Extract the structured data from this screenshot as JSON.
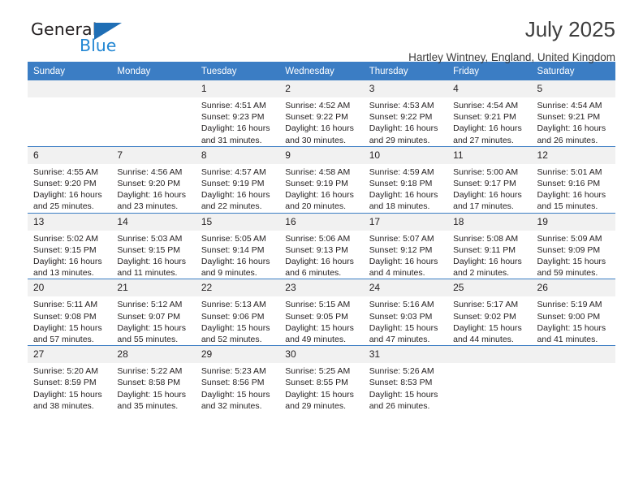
{
  "brand": {
    "name_part1": "General",
    "name_part2": "Blue",
    "triangle_color": "#1f6eb5",
    "blue_text_color": "#2387d3"
  },
  "header": {
    "month_title": "July 2025",
    "location": "Hartley Wintney, England, United Kingdom"
  },
  "theme": {
    "header_blue": "#3b7dc4",
    "daynum_bg": "#f1f1f1"
  },
  "weekday_headers": [
    "Sunday",
    "Monday",
    "Tuesday",
    "Wednesday",
    "Thursday",
    "Friday",
    "Saturday"
  ],
  "labels": {
    "sunrise_prefix": "Sunrise:",
    "sunset_prefix": "Sunset:",
    "daylight_prefix": "Daylight:"
  },
  "weeks": [
    [
      {
        "day": "",
        "empty": true
      },
      {
        "day": "",
        "empty": true
      },
      {
        "day": "1",
        "sunrise": "Sunrise: 4:51 AM",
        "sunset": "Sunset: 9:23 PM",
        "daylight_line1": "Daylight: 16 hours",
        "daylight_line2": "and 31 minutes."
      },
      {
        "day": "2",
        "sunrise": "Sunrise: 4:52 AM",
        "sunset": "Sunset: 9:22 PM",
        "daylight_line1": "Daylight: 16 hours",
        "daylight_line2": "and 30 minutes."
      },
      {
        "day": "3",
        "sunrise": "Sunrise: 4:53 AM",
        "sunset": "Sunset: 9:22 PM",
        "daylight_line1": "Daylight: 16 hours",
        "daylight_line2": "and 29 minutes."
      },
      {
        "day": "4",
        "sunrise": "Sunrise: 4:54 AM",
        "sunset": "Sunset: 9:21 PM",
        "daylight_line1": "Daylight: 16 hours",
        "daylight_line2": "and 27 minutes."
      },
      {
        "day": "5",
        "sunrise": "Sunrise: 4:54 AM",
        "sunset": "Sunset: 9:21 PM",
        "daylight_line1": "Daylight: 16 hours",
        "daylight_line2": "and 26 minutes."
      }
    ],
    [
      {
        "day": "6",
        "sunrise": "Sunrise: 4:55 AM",
        "sunset": "Sunset: 9:20 PM",
        "daylight_line1": "Daylight: 16 hours",
        "daylight_line2": "and 25 minutes."
      },
      {
        "day": "7",
        "sunrise": "Sunrise: 4:56 AM",
        "sunset": "Sunset: 9:20 PM",
        "daylight_line1": "Daylight: 16 hours",
        "daylight_line2": "and 23 minutes."
      },
      {
        "day": "8",
        "sunrise": "Sunrise: 4:57 AM",
        "sunset": "Sunset: 9:19 PM",
        "daylight_line1": "Daylight: 16 hours",
        "daylight_line2": "and 22 minutes."
      },
      {
        "day": "9",
        "sunrise": "Sunrise: 4:58 AM",
        "sunset": "Sunset: 9:19 PM",
        "daylight_line1": "Daylight: 16 hours",
        "daylight_line2": "and 20 minutes."
      },
      {
        "day": "10",
        "sunrise": "Sunrise: 4:59 AM",
        "sunset": "Sunset: 9:18 PM",
        "daylight_line1": "Daylight: 16 hours",
        "daylight_line2": "and 18 minutes."
      },
      {
        "day": "11",
        "sunrise": "Sunrise: 5:00 AM",
        "sunset": "Sunset: 9:17 PM",
        "daylight_line1": "Daylight: 16 hours",
        "daylight_line2": "and 17 minutes."
      },
      {
        "day": "12",
        "sunrise": "Sunrise: 5:01 AM",
        "sunset": "Sunset: 9:16 PM",
        "daylight_line1": "Daylight: 16 hours",
        "daylight_line2": "and 15 minutes."
      }
    ],
    [
      {
        "day": "13",
        "sunrise": "Sunrise: 5:02 AM",
        "sunset": "Sunset: 9:15 PM",
        "daylight_line1": "Daylight: 16 hours",
        "daylight_line2": "and 13 minutes."
      },
      {
        "day": "14",
        "sunrise": "Sunrise: 5:03 AM",
        "sunset": "Sunset: 9:15 PM",
        "daylight_line1": "Daylight: 16 hours",
        "daylight_line2": "and 11 minutes."
      },
      {
        "day": "15",
        "sunrise": "Sunrise: 5:05 AM",
        "sunset": "Sunset: 9:14 PM",
        "daylight_line1": "Daylight: 16 hours",
        "daylight_line2": "and 9 minutes."
      },
      {
        "day": "16",
        "sunrise": "Sunrise: 5:06 AM",
        "sunset": "Sunset: 9:13 PM",
        "daylight_line1": "Daylight: 16 hours",
        "daylight_line2": "and 6 minutes."
      },
      {
        "day": "17",
        "sunrise": "Sunrise: 5:07 AM",
        "sunset": "Sunset: 9:12 PM",
        "daylight_line1": "Daylight: 16 hours",
        "daylight_line2": "and 4 minutes."
      },
      {
        "day": "18",
        "sunrise": "Sunrise: 5:08 AM",
        "sunset": "Sunset: 9:11 PM",
        "daylight_line1": "Daylight: 16 hours",
        "daylight_line2": "and 2 minutes."
      },
      {
        "day": "19",
        "sunrise": "Sunrise: 5:09 AM",
        "sunset": "Sunset: 9:09 PM",
        "daylight_line1": "Daylight: 15 hours",
        "daylight_line2": "and 59 minutes."
      }
    ],
    [
      {
        "day": "20",
        "sunrise": "Sunrise: 5:11 AM",
        "sunset": "Sunset: 9:08 PM",
        "daylight_line1": "Daylight: 15 hours",
        "daylight_line2": "and 57 minutes."
      },
      {
        "day": "21",
        "sunrise": "Sunrise: 5:12 AM",
        "sunset": "Sunset: 9:07 PM",
        "daylight_line1": "Daylight: 15 hours",
        "daylight_line2": "and 55 minutes."
      },
      {
        "day": "22",
        "sunrise": "Sunrise: 5:13 AM",
        "sunset": "Sunset: 9:06 PM",
        "daylight_line1": "Daylight: 15 hours",
        "daylight_line2": "and 52 minutes."
      },
      {
        "day": "23",
        "sunrise": "Sunrise: 5:15 AM",
        "sunset": "Sunset: 9:05 PM",
        "daylight_line1": "Daylight: 15 hours",
        "daylight_line2": "and 49 minutes."
      },
      {
        "day": "24",
        "sunrise": "Sunrise: 5:16 AM",
        "sunset": "Sunset: 9:03 PM",
        "daylight_line1": "Daylight: 15 hours",
        "daylight_line2": "and 47 minutes."
      },
      {
        "day": "25",
        "sunrise": "Sunrise: 5:17 AM",
        "sunset": "Sunset: 9:02 PM",
        "daylight_line1": "Daylight: 15 hours",
        "daylight_line2": "and 44 minutes."
      },
      {
        "day": "26",
        "sunrise": "Sunrise: 5:19 AM",
        "sunset": "Sunset: 9:00 PM",
        "daylight_line1": "Daylight: 15 hours",
        "daylight_line2": "and 41 minutes."
      }
    ],
    [
      {
        "day": "27",
        "sunrise": "Sunrise: 5:20 AM",
        "sunset": "Sunset: 8:59 PM",
        "daylight_line1": "Daylight: 15 hours",
        "daylight_line2": "and 38 minutes."
      },
      {
        "day": "28",
        "sunrise": "Sunrise: 5:22 AM",
        "sunset": "Sunset: 8:58 PM",
        "daylight_line1": "Daylight: 15 hours",
        "daylight_line2": "and 35 minutes."
      },
      {
        "day": "29",
        "sunrise": "Sunrise: 5:23 AM",
        "sunset": "Sunset: 8:56 PM",
        "daylight_line1": "Daylight: 15 hours",
        "daylight_line2": "and 32 minutes."
      },
      {
        "day": "30",
        "sunrise": "Sunrise: 5:25 AM",
        "sunset": "Sunset: 8:55 PM",
        "daylight_line1": "Daylight: 15 hours",
        "daylight_line2": "and 29 minutes."
      },
      {
        "day": "31",
        "sunrise": "Sunrise: 5:26 AM",
        "sunset": "Sunset: 8:53 PM",
        "daylight_line1": "Daylight: 15 hours",
        "daylight_line2": "and 26 minutes."
      },
      {
        "day": "",
        "empty": true
      },
      {
        "day": "",
        "empty": true
      }
    ]
  ]
}
